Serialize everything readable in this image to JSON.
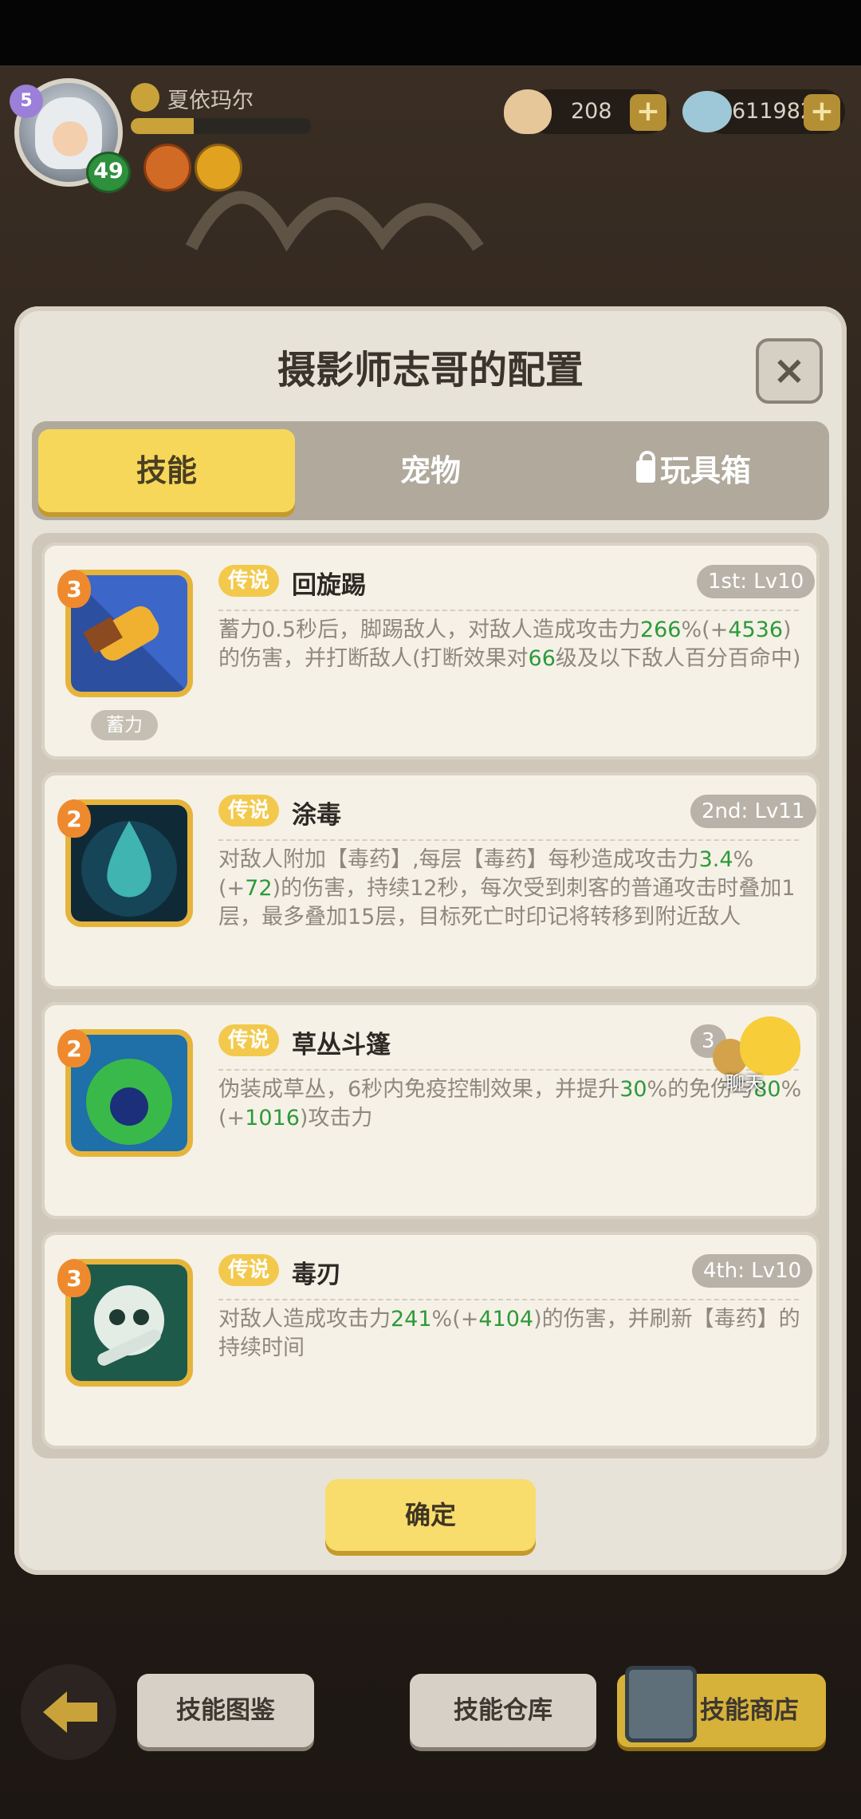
{
  "player": {
    "name": "夏依玛尔",
    "level": "49",
    "vip_label": "5",
    "exp_fraction": 0.35
  },
  "currency": {
    "shells": "208",
    "gems": "611982",
    "plus": "+"
  },
  "modal": {
    "title": "摄影师志哥的配置",
    "close": "×",
    "tabs": [
      {
        "label": "技能",
        "active": true
      },
      {
        "label": "宠物",
        "active": false
      },
      {
        "label": "玩具箱",
        "active": false,
        "locked": true
      }
    ],
    "skills": [
      {
        "rank": "3",
        "tag": "传说",
        "name": "回旋踢",
        "level": "1st: Lv10",
        "sub_label": "蓄力",
        "desc": [
          "蓄力0.5秒后，脚踢敌人，对敌人造成攻击力",
          "266",
          "%(+",
          "4536",
          ")的伤害，并打断敌人(打断效果对",
          "66",
          "级及以下敌人百分百命中)"
        ]
      },
      {
        "rank": "2",
        "tag": "传说",
        "name": "涂毒",
        "level": "2nd: Lv11",
        "desc": [
          "对敌人附加【毒药】,每层【毒药】每秒造成攻击力",
          "3.4",
          "%(+",
          "72",
          ")的伤害，持续12秒，每次受到刺客的普通攻击时叠加1层，最多叠加15层，目标死亡时印记将转移到附近敌人"
        ]
      },
      {
        "rank": "2",
        "tag": "传说",
        "name": "草丛斗篷",
        "level": "3",
        "desc": [
          "伪装成草丛，6秒内免疫控制效果，并提升",
          "30",
          "%的免伤与",
          "80",
          "%(+",
          "1016",
          ")攻击力"
        ]
      },
      {
        "rank": "3",
        "tag": "传说",
        "name": "毒刃",
        "level": "4th: Lv10",
        "desc": [
          "对敌人造成攻击力",
          "241",
          "%(+",
          "4104",
          ")的伤害，并刷新【毒药】的持续时间"
        ]
      }
    ],
    "confirm": "确定"
  },
  "chat": {
    "label": "聊天"
  },
  "bottom": {
    "skill_codex": "技能图鉴",
    "skill_storage": "技能仓库",
    "skill_shop": "技能商店"
  }
}
